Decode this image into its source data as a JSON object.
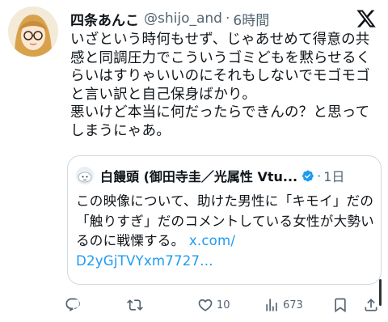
{
  "tweet": {
    "display_name": "四条あんこ",
    "handle": "@shijo_and",
    "separator": "·",
    "time": "6時間",
    "text": "いざという時何もせず、じゃあせめて得意の共感と同調圧力でこういうゴミどもを黙らせるくらいはすりゃいいのにそれもしないでモゴモゴと言い訳と自己保身ばかり。\n悪いけど本当に何だったらできんの？と思ってしまうにゃあ。"
  },
  "quote": {
    "display_name": "白饅頭 (御田寺圭／光属性 Vtu...",
    "separator": "·",
    "time": "1日",
    "text": "この映像について、助けた男性に「キモイ」だの「触りすぎ」だのコメントしている女性が大勢いるのに戦慄する。 ",
    "link": "x.com/\nD2yGjTVYxm7727..."
  },
  "actions": {
    "reply_count": "",
    "retweet_count": "",
    "like_count": "10",
    "views_count": "673"
  },
  "colors": {
    "text": "#0f1419",
    "secondary": "#536471",
    "link": "#1d9bf0",
    "border": "#cfd9de",
    "verified": "#1d9bf0"
  },
  "icons": {
    "header_logo": "x-logo-icon",
    "verified": "verified-badge-icon",
    "reply": "reply-icon",
    "retweet": "retweet-icon",
    "like": "like-icon",
    "views": "views-icon",
    "bookmark": "bookmark-icon",
    "share": "share-icon"
  }
}
